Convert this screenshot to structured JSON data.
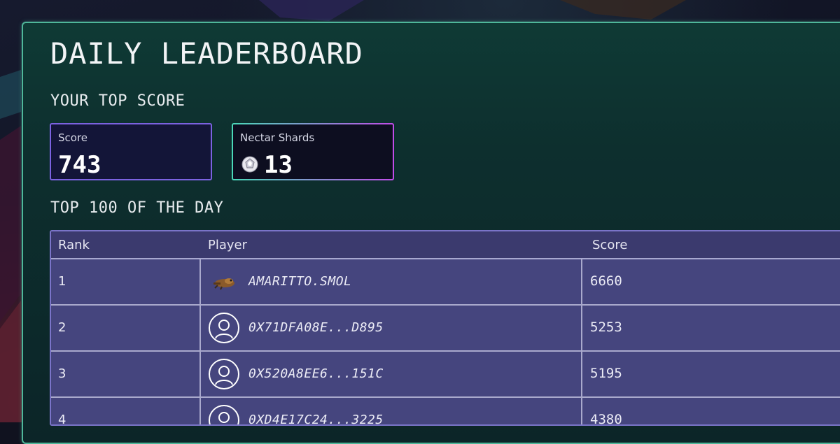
{
  "title": "DAILY LEADERBOARD",
  "your_top_score": {
    "heading": "YOUR TOP SCORE",
    "score": {
      "label": "Score",
      "value": "743"
    },
    "shards": {
      "label": "Nectar Shards",
      "value": "13",
      "icon": "nectar-shard-icon"
    }
  },
  "top100": {
    "heading": "TOP 100 OF THE DAY",
    "columns": [
      "Rank",
      "Player",
      "Score"
    ],
    "rows": [
      {
        "rank": "1",
        "player": "AMARITTO.SMOL",
        "score": "6660",
        "avatar": "character-avatar"
      },
      {
        "rank": "2",
        "player": "0X71DFA08E...D895",
        "score": "5253",
        "avatar": "default-user-icon"
      },
      {
        "rank": "3",
        "player": "0X520A8EE6...151C",
        "score": "5195",
        "avatar": "default-user-icon"
      },
      {
        "rank": "4",
        "player": "0XD4E17C24...3225",
        "score": "4380",
        "avatar": "default-user-icon"
      }
    ]
  },
  "colors": {
    "panel_border": "#4fb79a",
    "score_border": "#7b62e0",
    "shards_border_start": "#4ad8b8",
    "shards_border_end": "#c04ce8",
    "table_bg": "#45457e"
  }
}
